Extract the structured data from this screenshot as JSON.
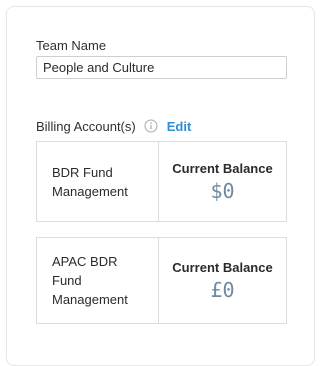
{
  "team": {
    "label": "Team Name",
    "value": "People and Culture"
  },
  "billing": {
    "label": "Billing Account(s)",
    "info_icon": "info-circle-icon",
    "edit_label": "Edit",
    "edit_color": "#2d8fd8",
    "accounts": [
      {
        "name": "BDR Fund Management",
        "balance_title": "Current Balance",
        "balance": "$0"
      },
      {
        "name": "APAC BDR Fund Management",
        "balance_title": "Current Balance",
        "balance": "£0"
      }
    ]
  }
}
